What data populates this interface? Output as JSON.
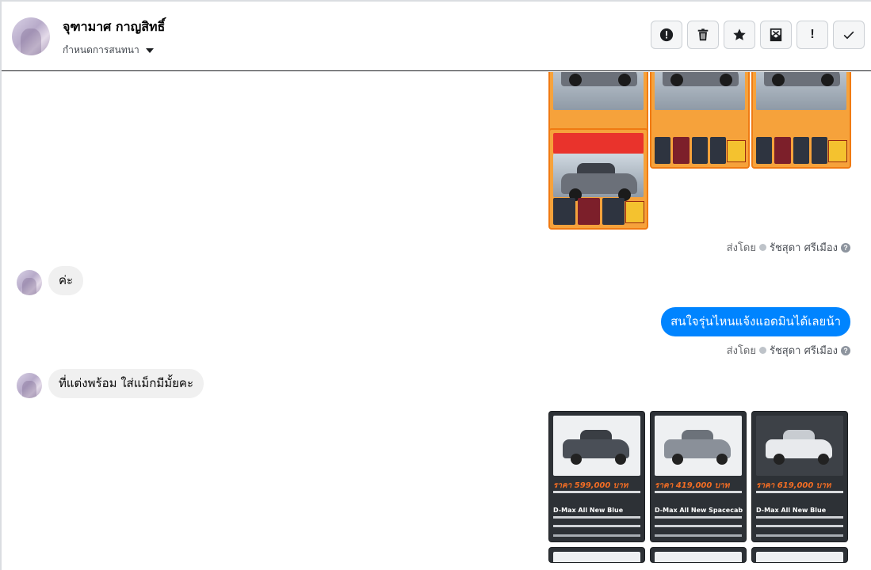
{
  "header": {
    "contact_name": "จุฑามาศ กาญสิทธิ์",
    "conversation_settings": "กำหนดการสนทนา",
    "actions": [
      {
        "name": "report-spam-button",
        "icon": "alert-circle-icon"
      },
      {
        "name": "delete-button",
        "icon": "trash-icon"
      },
      {
        "name": "star-button",
        "icon": "star-icon"
      },
      {
        "name": "mark-unread-button",
        "icon": "envelope-icon"
      },
      {
        "name": "important-button",
        "icon": "exclamation-icon",
        "label": "!"
      },
      {
        "name": "mark-done-button",
        "icon": "checkmark-icon"
      }
    ]
  },
  "thread": {
    "sent_by_prefix": "ส่งโดย",
    "sent_by_name": "รัชสุดา ศรีเมือง",
    "messages": [
      {
        "direction": "incoming",
        "text": "ค่ะ"
      },
      {
        "direction": "outgoing",
        "text": "สนใจรุ่นไหนแจ้งแอดมินได้เลยน้า"
      },
      {
        "direction": "incoming",
        "text": "ที่แต่งพร้อม  ใส่แม็กมีมั้ยคะ"
      }
    ],
    "product_cards": [
      {
        "price": "ราคา 599,000 บาท",
        "model": "D-Max All New Blue",
        "car_color": "#4a4f57"
      },
      {
        "price": "ราคา 419,000 บาท",
        "model": "D-Max All New Spacecab",
        "car_color": "#8a9099"
      },
      {
        "price": "ราคา 619,000 บาท",
        "model": "D-Max All New Blue",
        "car_color": "#e8eaed"
      }
    ]
  },
  "colors": {
    "accent": "#0084ff",
    "ad_border": "#f07a12",
    "price_text": "#f26d24"
  }
}
